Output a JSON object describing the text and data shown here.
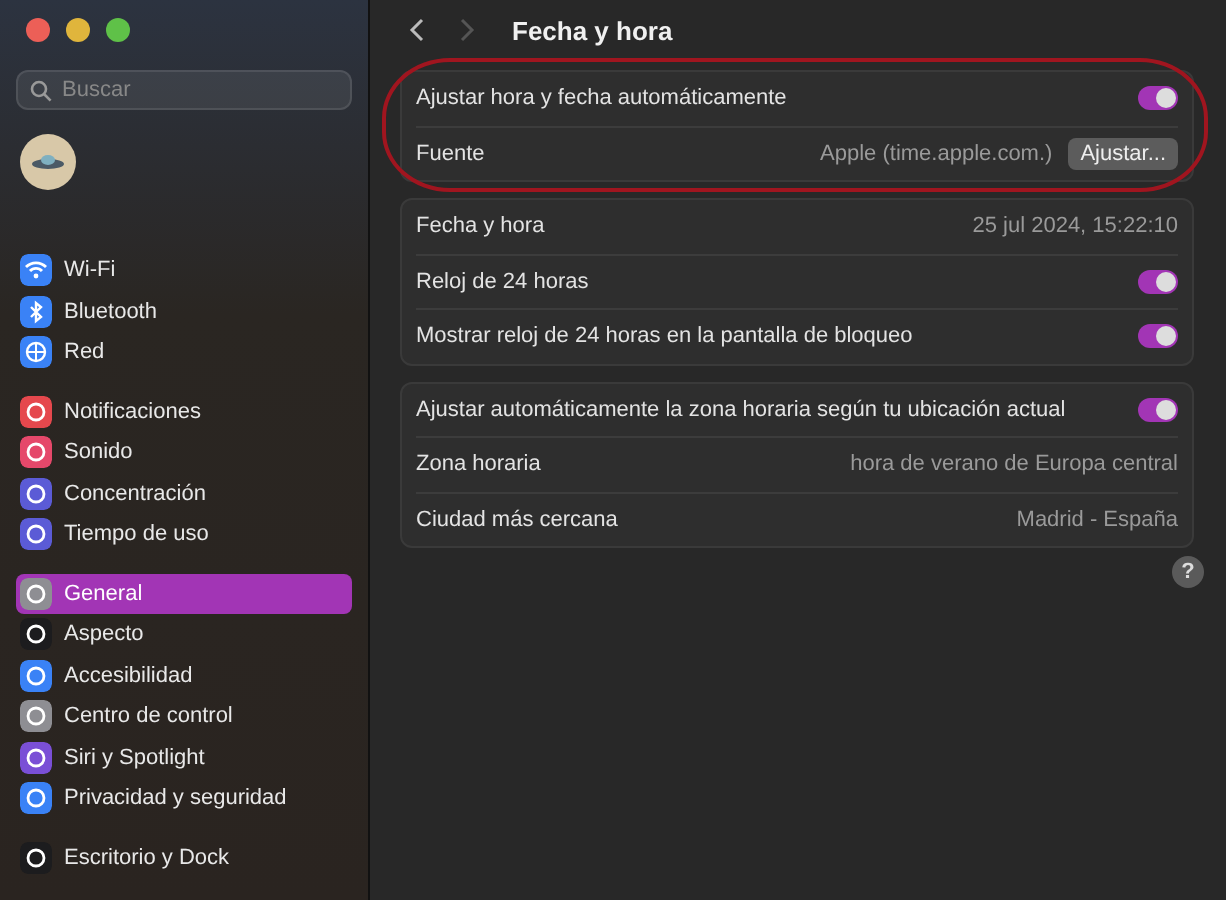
{
  "window": {
    "title": "Fecha y hora"
  },
  "search": {
    "placeholder": "Buscar"
  },
  "sidebar": {
    "sections": [
      [
        {
          "label": "Wi-Fi",
          "selected": false,
          "color": "#3a82f6"
        },
        {
          "label": "Bluetooth",
          "selected": false,
          "color": "#3a82f6"
        },
        {
          "label": "Red",
          "selected": false,
          "color": "#3a82f6"
        }
      ],
      [
        {
          "label": "Notificaciones",
          "selected": false,
          "color": "#e5484d"
        },
        {
          "label": "Sonido",
          "selected": false,
          "color": "#e5486a"
        },
        {
          "label": "Concentración",
          "selected": false,
          "color": "#5b5bd6"
        },
        {
          "label": "Tiempo de uso",
          "selected": false,
          "color": "#5b5bd6"
        }
      ],
      [
        {
          "label": "General",
          "selected": true,
          "color": "#8e8e93"
        },
        {
          "label": "Aspecto",
          "selected": false,
          "color": "#1c1c1e"
        },
        {
          "label": "Accesibilidad",
          "selected": false,
          "color": "#3a82f6"
        },
        {
          "label": "Centro de control",
          "selected": false,
          "color": "#8e8e93"
        },
        {
          "label": "Siri y Spotlight",
          "selected": false,
          "color": "#7a4fd6"
        },
        {
          "label": "Privacidad y seguridad",
          "selected": false,
          "color": "#3a82f6"
        }
      ],
      [
        {
          "label": "Escritorio y Dock",
          "selected": false,
          "color": "#1c1c1e"
        }
      ]
    ]
  },
  "groups": [
    {
      "highlighted": true,
      "rows": [
        {
          "kind": "toggle",
          "label": "Ajustar hora y fecha automáticamente",
          "on": true
        },
        {
          "kind": "button",
          "label": "Fuente",
          "value": "Apple (time.apple.com.)",
          "button": "Ajustar..."
        }
      ]
    },
    {
      "highlighted": false,
      "rows": [
        {
          "kind": "value",
          "label": "Fecha y hora",
          "value": "25 jul 2024, 15:22:10"
        },
        {
          "kind": "toggle",
          "label": "Reloj de 24 horas",
          "on": true
        },
        {
          "kind": "toggle",
          "label": "Mostrar reloj de 24 horas en la pantalla de bloqueo",
          "on": true
        }
      ]
    },
    {
      "highlighted": false,
      "rows": [
        {
          "kind": "toggle",
          "label": "Ajustar automáticamente la zona horaria según tu ubicación actual",
          "on": true
        },
        {
          "kind": "value",
          "label": "Zona horaria",
          "value": "hora de verano de Europa central"
        },
        {
          "kind": "value",
          "label": "Ciudad más cercana",
          "value": "Madrid - España"
        }
      ]
    }
  ],
  "help": {
    "label": "?"
  }
}
